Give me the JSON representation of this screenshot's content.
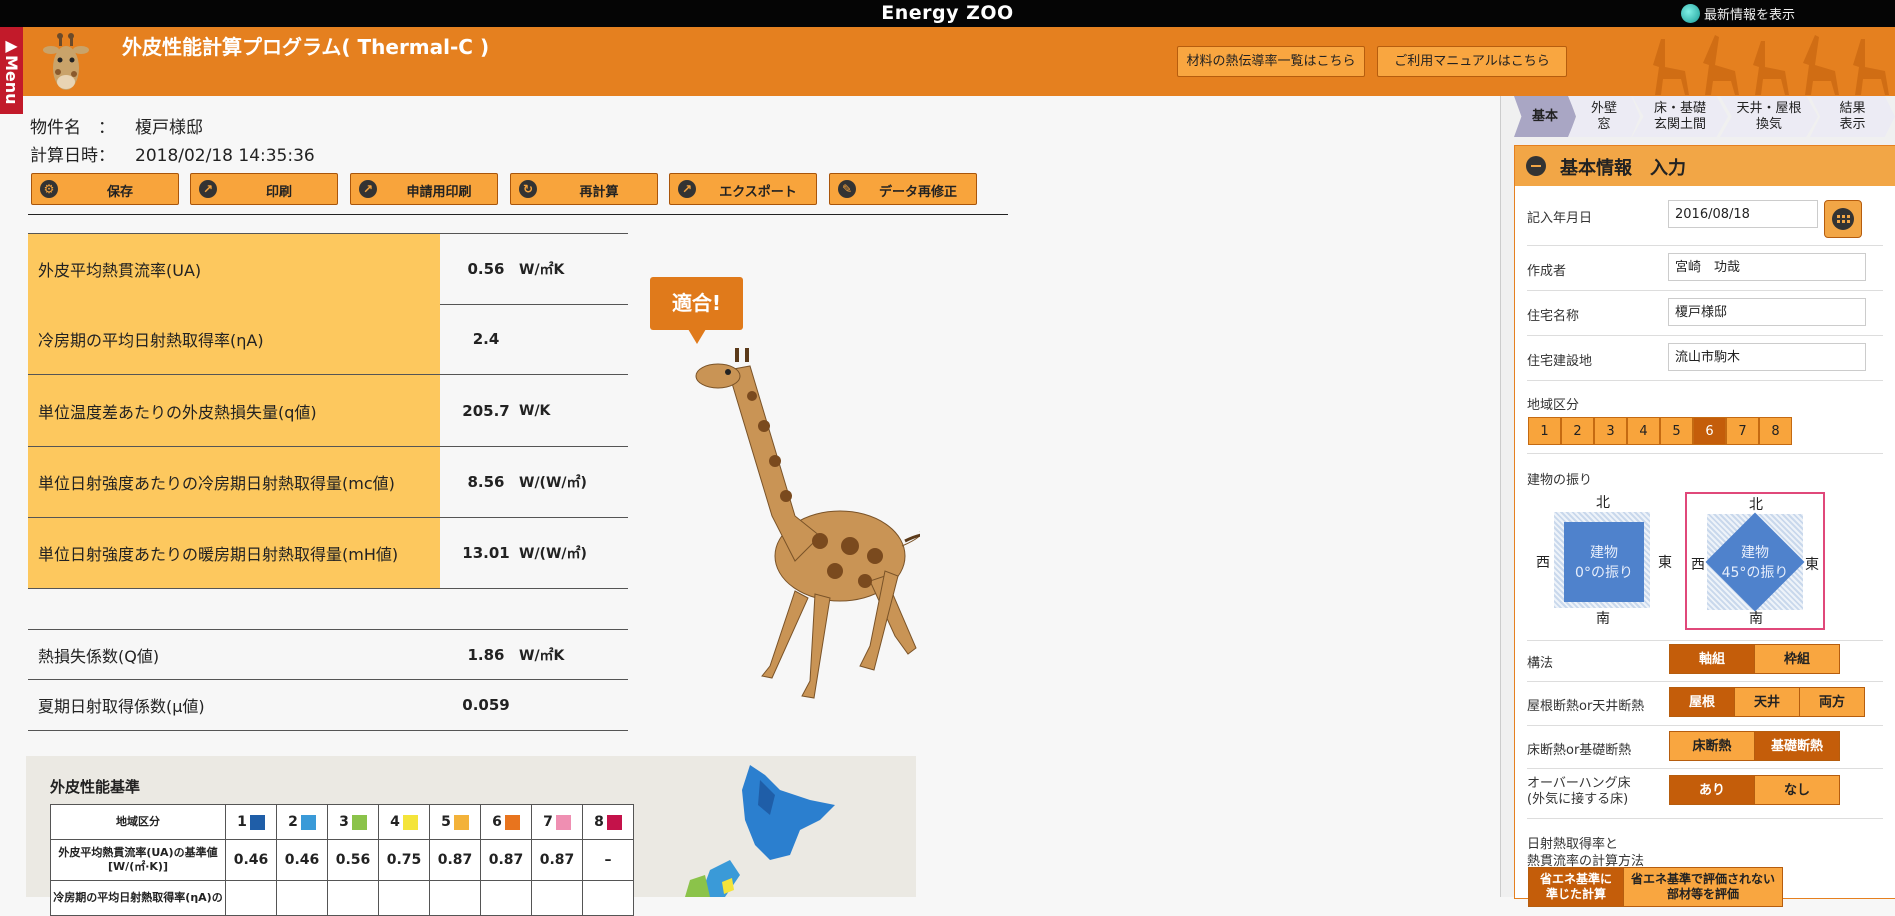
{
  "topbar": {
    "title": "Energy ZOO",
    "news": "最新情報を表示"
  },
  "header": {
    "menu": "▶Menu",
    "title": "外皮性能計算プログラム( Thermal-C )",
    "btn_materials": "材料の熱伝導率一覧はこちら",
    "btn_manual": "ご利用マニュアルはこちら"
  },
  "info": {
    "name_label": "物件名　：",
    "name_value": "榎戸様邸",
    "date_label": "計算日時：",
    "date_value": "2018/02/18 14:35:36"
  },
  "actions": [
    {
      "label": "保存",
      "icon": "gear-icon"
    },
    {
      "label": "印刷",
      "icon": "export-icon"
    },
    {
      "label": "申請用印刷",
      "icon": "export-icon"
    },
    {
      "label": "再計算",
      "icon": "refresh-icon"
    },
    {
      "label": "エクスポート",
      "icon": "export-icon"
    },
    {
      "label": "データ再修正",
      "icon": "pencil-icon"
    }
  ],
  "results": [
    {
      "name": "外皮平均熱貫流率(UA)",
      "value": "0.56",
      "unit": "W/㎡K"
    },
    {
      "name": "冷房期の平均日射熱取得率(ηA)",
      "value": "2.4",
      "unit": ""
    },
    {
      "name": "単位温度差あたりの外皮熱損失量(q値)",
      "value": "205.7",
      "unit": "W/K"
    },
    {
      "name": "単位日射強度あたりの冷房期日射熱取得量(mc値)",
      "value": "8.56",
      "unit": "W/(W/㎡)"
    },
    {
      "name": "単位日射強度あたりの暖房期日射熱取得量(mH値)",
      "value": "13.01",
      "unit": "W/(W/㎡)"
    }
  ],
  "results2": [
    {
      "name": "熱損失係数(Q値)",
      "value": "1.86",
      "unit": "W/㎡K"
    },
    {
      "name": "夏期日射取得係数(μ値)",
      "value": "0.059",
      "unit": ""
    }
  ],
  "fit_label": "適合!",
  "standard": {
    "title": "外皮性能基準",
    "region_header": "地域区分",
    "ua_header": "外皮平均熱貫流率(UA)の基準値[W/(㎡·K)]",
    "next_header": "冷房期の平均日射熱取得率(ηA)の",
    "regions": [
      {
        "n": "1",
        "color": "#1f5ea8",
        "ua": "0.46"
      },
      {
        "n": "2",
        "color": "#3a9ad8",
        "ua": "0.46"
      },
      {
        "n": "3",
        "color": "#8bc34a",
        "ua": "0.56"
      },
      {
        "n": "4",
        "color": "#f4e43a",
        "ua": "0.75"
      },
      {
        "n": "5",
        "color": "#f3b23a",
        "ua": "0.87"
      },
      {
        "n": "6",
        "color": "#e8741e",
        "ua": "0.87"
      },
      {
        "n": "7",
        "color": "#ef8fb2",
        "ua": "0.87"
      },
      {
        "n": "8",
        "color": "#c4124a",
        "ua": "–"
      }
    ]
  },
  "steps": [
    {
      "label": "基本",
      "active": true
    },
    {
      "label": "外壁\n窓",
      "active": false
    },
    {
      "label": "床・基礎\n玄関土間",
      "active": false
    },
    {
      "label": "天井・屋根\n換気",
      "active": false
    },
    {
      "label": "結果\n表示",
      "active": false
    }
  ],
  "panel": {
    "title": "基本情報　入力",
    "date_label": "記入年月日",
    "date_value": "2016/08/18",
    "author_label": "作成者",
    "author_value": "宮崎　功哉",
    "house_label": "住宅名称",
    "house_value": "榎戸様邸",
    "site_label": "住宅建設地",
    "site_value": "流山市駒木",
    "region_label": "地域区分",
    "regions": [
      "1",
      "2",
      "3",
      "4",
      "5",
      "6",
      "7",
      "8"
    ],
    "region_selected": "6",
    "orient_label": "建物の振り",
    "north": "北",
    "south": "南",
    "east": "東",
    "west": "西",
    "orient0": "建物\n0°の振り",
    "orient45": "建物\n45°の振り",
    "structure_label": "構法",
    "structure_opts": [
      "軸組",
      "枠組"
    ],
    "roof_label": "屋根断熱or天井断熱",
    "roof_opts": [
      "屋根",
      "天井",
      "両方"
    ],
    "floor_label": "床断熱or基礎断熱",
    "floor_opts": [
      "床断熱",
      "基礎断熱"
    ],
    "overhang_label": "オーバーハング床\n(外気に接する床)",
    "overhang_opts": [
      "あり",
      "なし"
    ],
    "solar_label": "日射熱取得率と\n熱貫流率の計算方法",
    "solar_opts": [
      "省エネ基準に\n準じた計算",
      "省エネ基準で評価されない\n部材等を評価"
    ]
  }
}
